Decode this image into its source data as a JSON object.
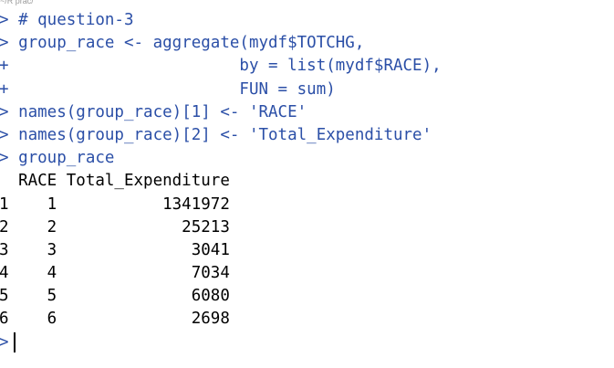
{
  "path_bar": {
    "text": "~/R prac/"
  },
  "console": {
    "lines": [
      {
        "prompt": "> ",
        "text": "# question-3",
        "kind": "input"
      },
      {
        "prompt": "> ",
        "text": "group_race <- aggregate(mydf$TOTCHG,",
        "kind": "input"
      },
      {
        "prompt": "+ ",
        "text": "                       by = list(mydf$RACE),",
        "kind": "input"
      },
      {
        "prompt": "+ ",
        "text": "                       FUN = sum)",
        "kind": "input"
      },
      {
        "prompt": "> ",
        "text": "names(group_race)[1] <- 'RACE'",
        "kind": "input"
      },
      {
        "prompt": "> ",
        "text": "names(group_race)[2] <- 'Total_Expenditure'",
        "kind": "input"
      },
      {
        "prompt": "> ",
        "text": "group_race",
        "kind": "input"
      },
      {
        "prompt": "",
        "text": "  RACE Total_Expenditure",
        "kind": "output"
      },
      {
        "prompt": "",
        "text": "1    1           1341972",
        "kind": "output"
      },
      {
        "prompt": "",
        "text": "2    2             25213",
        "kind": "output"
      },
      {
        "prompt": "",
        "text": "3    3              3041",
        "kind": "output"
      },
      {
        "prompt": "",
        "text": "4    4              7034",
        "kind": "output"
      },
      {
        "prompt": "",
        "text": "5    5              6080",
        "kind": "output"
      },
      {
        "prompt": "",
        "text": "6    6              2698",
        "kind": "output"
      }
    ],
    "active_prompt": ">"
  },
  "colors": {
    "input": "#2b4fa7",
    "output": "#000000",
    "background": "#ffffff"
  }
}
